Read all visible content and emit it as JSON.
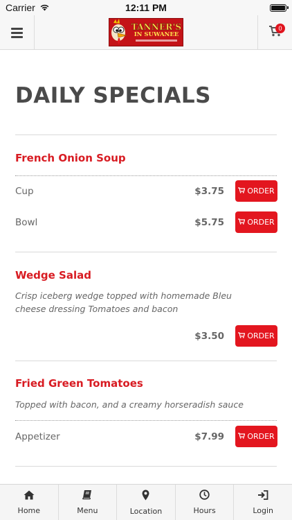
{
  "status_bar": {
    "carrier": "Carrier",
    "time": "12:11 PM",
    "battery_level": 1.0
  },
  "header": {
    "logo": {
      "line1": "TANNER'S",
      "line2": "IN SUWANEE",
      "icon": "rooster-mascot"
    },
    "menu_icon": "hamburger-menu-icon",
    "cart_icon": "shopping-cart-icon",
    "cart_count": "0"
  },
  "page": {
    "title": "DAILY SPECIALS"
  },
  "items": [
    {
      "name": "French Onion Soup",
      "description": "",
      "options": [
        {
          "label": "Cup",
          "price": "$3.75",
          "order_label": "ORDER"
        },
        {
          "label": "Bowl",
          "price": "$5.75",
          "order_label": "ORDER"
        }
      ]
    },
    {
      "name": "Wedge Salad",
      "description": "Crisp iceberg wedge topped with homemade Bleu cheese dressing Tomatoes and bacon",
      "options": [
        {
          "label": "",
          "price": "$3.50",
          "order_label": "ORDER"
        }
      ]
    },
    {
      "name": "Fried Green Tomatoes",
      "description": "Topped with bacon, and a creamy horseradish sauce",
      "options": [
        {
          "label": "Appetizer",
          "price": "$7.99",
          "order_label": "ORDER"
        }
      ]
    }
  ],
  "tab_bar": [
    {
      "label": "Home",
      "icon": "home-icon"
    },
    {
      "label": "Menu",
      "icon": "book-icon"
    },
    {
      "label": "Location",
      "icon": "map-pin-icon"
    },
    {
      "label": "Hours",
      "icon": "clock-icon"
    },
    {
      "label": "Login",
      "icon": "login-icon"
    }
  ],
  "colors": {
    "accent": "#e3161f",
    "item_name": "#d81b22",
    "title": "#4a4a4a",
    "text_muted": "#666666",
    "bar_background": "#f7f7f7"
  }
}
